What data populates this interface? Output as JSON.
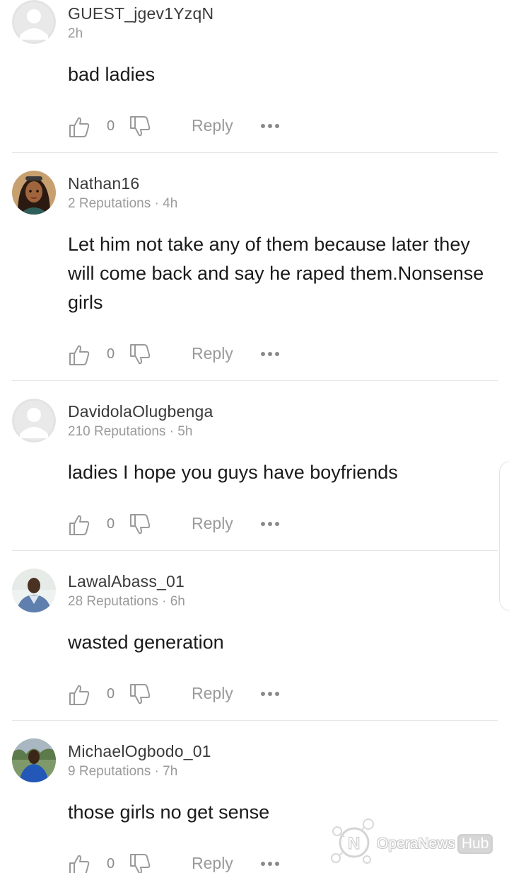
{
  "comments": [
    {
      "username": "GUEST_jgev1YzqN",
      "meta": "2h",
      "text": "bad ladies",
      "likes": "0",
      "reply_label": "Reply",
      "avatar": "default-avatar"
    },
    {
      "username": "Nathan16",
      "meta": "2 Reputations · 4h",
      "text": "Let him not take any of them because later they will come back and say he raped them.Nonsense girls",
      "likes": "0",
      "reply_label": "Reply",
      "avatar": "illustrated-avatar"
    },
    {
      "username": "DavidolaOlugbenga",
      "meta": "210 Reputations · 5h",
      "text": "ladies I hope you guys have boyfriends",
      "likes": "0",
      "reply_label": "Reply",
      "avatar": "default-avatar"
    },
    {
      "username": "LawalAbass_01",
      "meta": "28 Reputations · 6h",
      "text": "wasted generation",
      "likes": "0",
      "reply_label": "Reply",
      "avatar": "photo-avatar"
    },
    {
      "username": "MichaelOgbodo_01",
      "meta": "9 Reputations · 7h",
      "text": "those girls no get sense",
      "likes": "0",
      "reply_label": "Reply",
      "avatar": "photo-avatar"
    }
  ],
  "watermark": {
    "brand": "OperaNews",
    "badge": "Hub"
  },
  "colors": {
    "text": "#1a1a1a",
    "username": "#3a3a3a",
    "muted": "#9a9a9a",
    "divider": "#e6e6e6"
  }
}
